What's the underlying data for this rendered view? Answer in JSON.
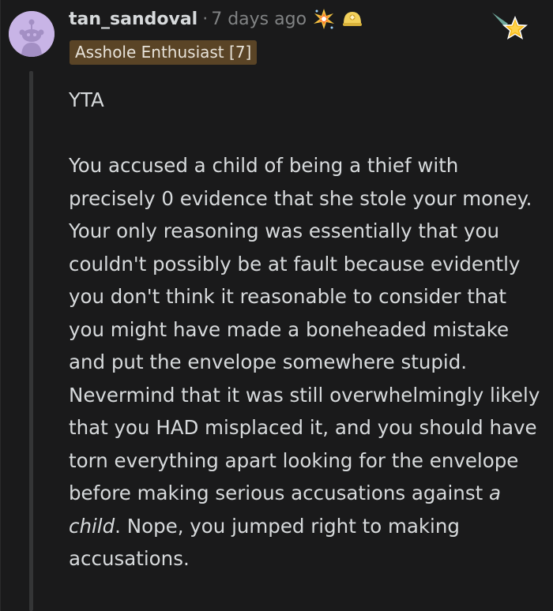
{
  "comment": {
    "author": "tan_sandoval",
    "separator": "·",
    "time_ago": "7 days ago",
    "awards": [
      "sparkle-explosion-award-icon",
      "helmet-award-icon"
    ],
    "flair": "Asshole Enthusiast [7]",
    "badge": "star-badge-icon",
    "paragraphs": {
      "p1": "YTA",
      "p2_before": "You accused a child of being a thief with precisely 0 evidence that she stole your money. Your only reasoning was essentially that you couldn't possibly be at fault because evidently you don't think it reasonable to consider that you might have made a boneheaded mistake and put the envelope somewhere stupid. Nevermind that it was still overwhelmingly likely that you HAD misplaced it, and you should have torn everything apart looking for the envelope before making serious accusations against ",
      "p2_italic": "a child",
      "p2_after": ". Nope, you jumped right to making accusations."
    }
  },
  "colors": {
    "background": "#1a1a1b",
    "text": "#d7dadc",
    "muted": "#818384",
    "flair_bg": "#5a4426",
    "avatar_bg": "#c8b4e6"
  }
}
